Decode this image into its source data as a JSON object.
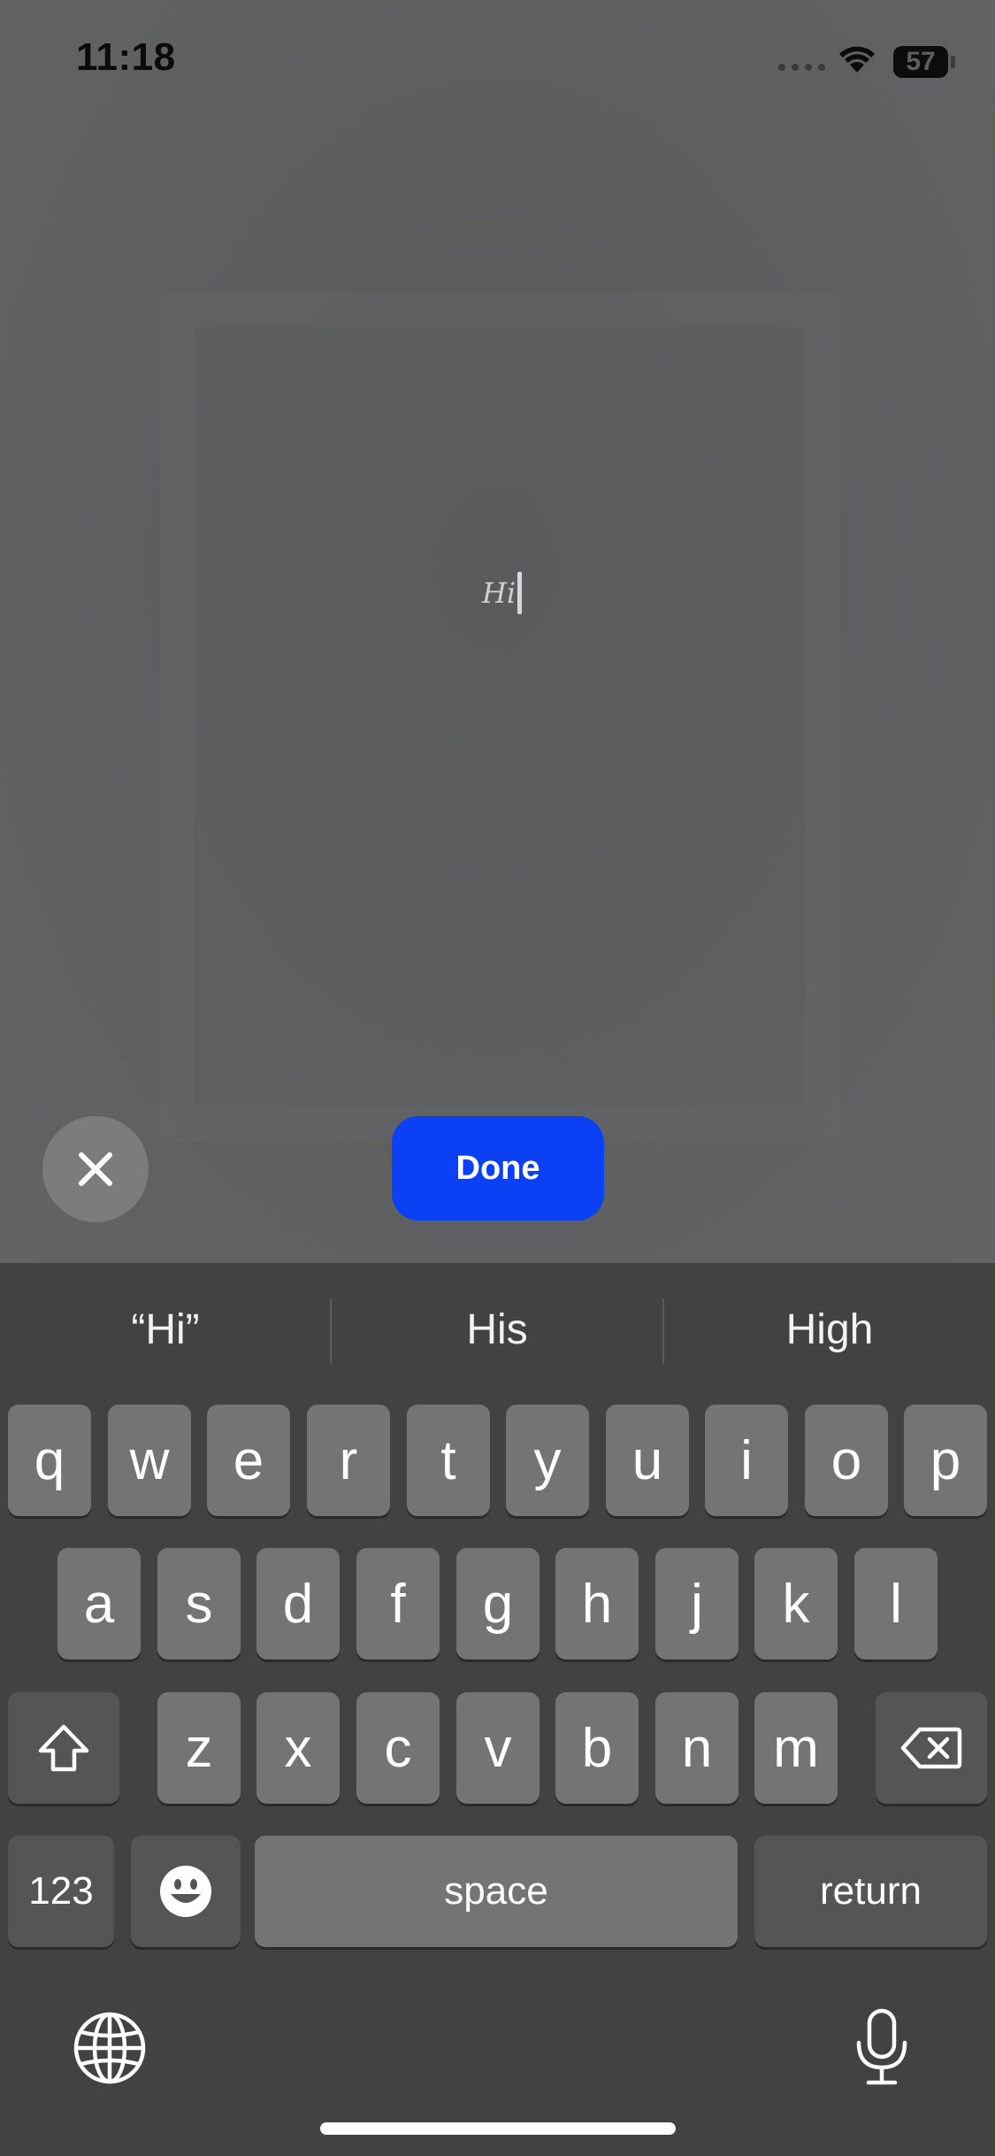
{
  "status_bar": {
    "time": "11:18",
    "battery_level": "57",
    "icons": [
      "signal-dots-icon",
      "wifi-icon",
      "battery-icon"
    ]
  },
  "editor": {
    "typed_text": "Hi"
  },
  "controls": {
    "close_icon": "close-icon",
    "done_label": "Done",
    "done_color": "#0c40f5"
  },
  "keyboard": {
    "suggestions": [
      "“Hi”",
      "His",
      "High"
    ],
    "row1": [
      "q",
      "w",
      "e",
      "r",
      "t",
      "y",
      "u",
      "i",
      "o",
      "p"
    ],
    "row2": [
      "a",
      "s",
      "d",
      "f",
      "g",
      "h",
      "j",
      "k",
      "l"
    ],
    "row3": [
      "z",
      "x",
      "c",
      "v",
      "b",
      "n",
      "m"
    ],
    "numbers_label": "123",
    "space_label": "space",
    "return_label": "return",
    "icons": [
      "shift-icon",
      "backspace-icon",
      "emoji-icon",
      "globe-icon",
      "microphone-icon"
    ]
  }
}
